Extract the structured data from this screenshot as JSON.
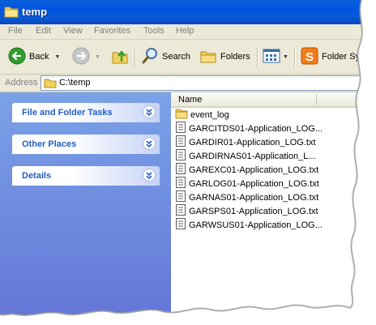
{
  "window": {
    "title": "temp"
  },
  "menu": [
    "File",
    "Edit",
    "View",
    "Favorites",
    "Tools",
    "Help"
  ],
  "toolbar": {
    "back_label": "Back",
    "search_label": "Search",
    "folders_label": "Folders",
    "foldersync_label": "Folder Syn"
  },
  "address": {
    "label": "Address",
    "value": "C:\\temp"
  },
  "taskpane": {
    "panels": [
      {
        "title": "File and Folder Tasks"
      },
      {
        "title": "Other Places"
      },
      {
        "title": "Details"
      }
    ]
  },
  "filelist": {
    "column_header": "Name",
    "items": [
      {
        "name": "event_log",
        "icon": "folder-icon"
      },
      {
        "name": "GARCITDS01-Application_LOG...",
        "icon": "text-file-icon"
      },
      {
        "name": "GARDIR01-Application_LOG.txt",
        "icon": "text-file-icon"
      },
      {
        "name": "GARDIRNAS01-Application_L...",
        "icon": "text-file-icon"
      },
      {
        "name": "GAREXC01-Application_LOG.txt",
        "icon": "text-file-icon"
      },
      {
        "name": "GARLOG01-Application_LOG.txt",
        "icon": "text-file-icon"
      },
      {
        "name": "GARNAS01-Application_LOG.txt",
        "icon": "text-file-icon"
      },
      {
        "name": "GARSPS01-Application_LOG.txt",
        "icon": "text-file-icon"
      },
      {
        "name": "GARWSUS01-Application_LOG...",
        "icon": "text-file-icon"
      }
    ]
  },
  "colors": {
    "titlebar": "#0054e3",
    "taskpane_top": "#7ba2e7",
    "taskpane_bottom": "#6375d6",
    "panel_title": "#215dc6",
    "chrome": "#ece9d8"
  }
}
